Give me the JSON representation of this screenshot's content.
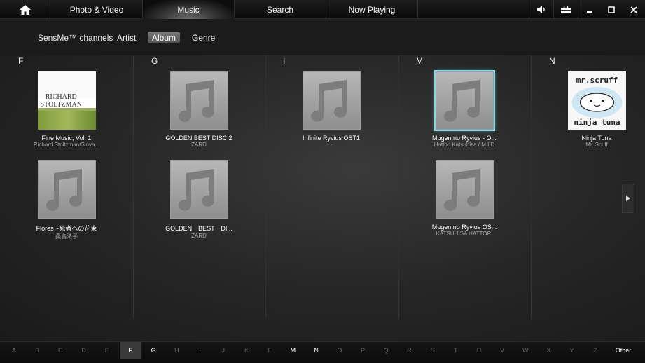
{
  "tabs": [
    {
      "label": "Photo & Video"
    },
    {
      "label": "Music"
    },
    {
      "label": "Search"
    },
    {
      "label": "Now Playing"
    }
  ],
  "subtabs": [
    {
      "label": "SensMe™ channels"
    },
    {
      "label": "Artist"
    },
    {
      "label": "Album"
    },
    {
      "label": "Genre"
    }
  ],
  "columns": [
    {
      "letter": "F"
    },
    {
      "letter": "G"
    },
    {
      "letter": "I"
    },
    {
      "letter": "M"
    },
    {
      "letter": "N"
    }
  ],
  "albums": [
    {
      "title": "Fine Music, Vol. 1",
      "artist": "Richard Stoltzman/Slova..."
    },
    {
      "title": "Flores ~死者への花束",
      "artist": "桑島法子"
    },
    {
      "title": "GOLDEN BEST DISC 2",
      "artist": "ZARD"
    },
    {
      "title": "GOLDEN　BEST　DI...",
      "artist": "ZARD"
    },
    {
      "title": "Infinite Ryvius OST1",
      "artist": "-"
    },
    {
      "title": "Mugen no Ryvius - O...",
      "artist": "Hattori Katsuhisa / M.I.D"
    },
    {
      "title": "Mugen no Ryvius OS...",
      "artist": "KATSUHISA HATTORI"
    },
    {
      "title": "Ninja Tuna",
      "artist": "Mr. Scuff"
    }
  ],
  "covers": {
    "richard_line1": "RICHARD",
    "richard_line2": "STOLTZMAN",
    "mrscruff_line1": "mr.scruff",
    "mrscruff_line2": "ninja tuna"
  },
  "alphabet": [
    "A",
    "B",
    "C",
    "D",
    "E",
    "F",
    "G",
    "H",
    "I",
    "J",
    "K",
    "L",
    "M",
    "N",
    "O",
    "P",
    "Q",
    "R",
    "S",
    "T",
    "U",
    "V",
    "W",
    "X",
    "Y",
    "Z"
  ],
  "alphabet_other": "Other",
  "colors": {
    "accent_selected": "#7fd8e6"
  }
}
